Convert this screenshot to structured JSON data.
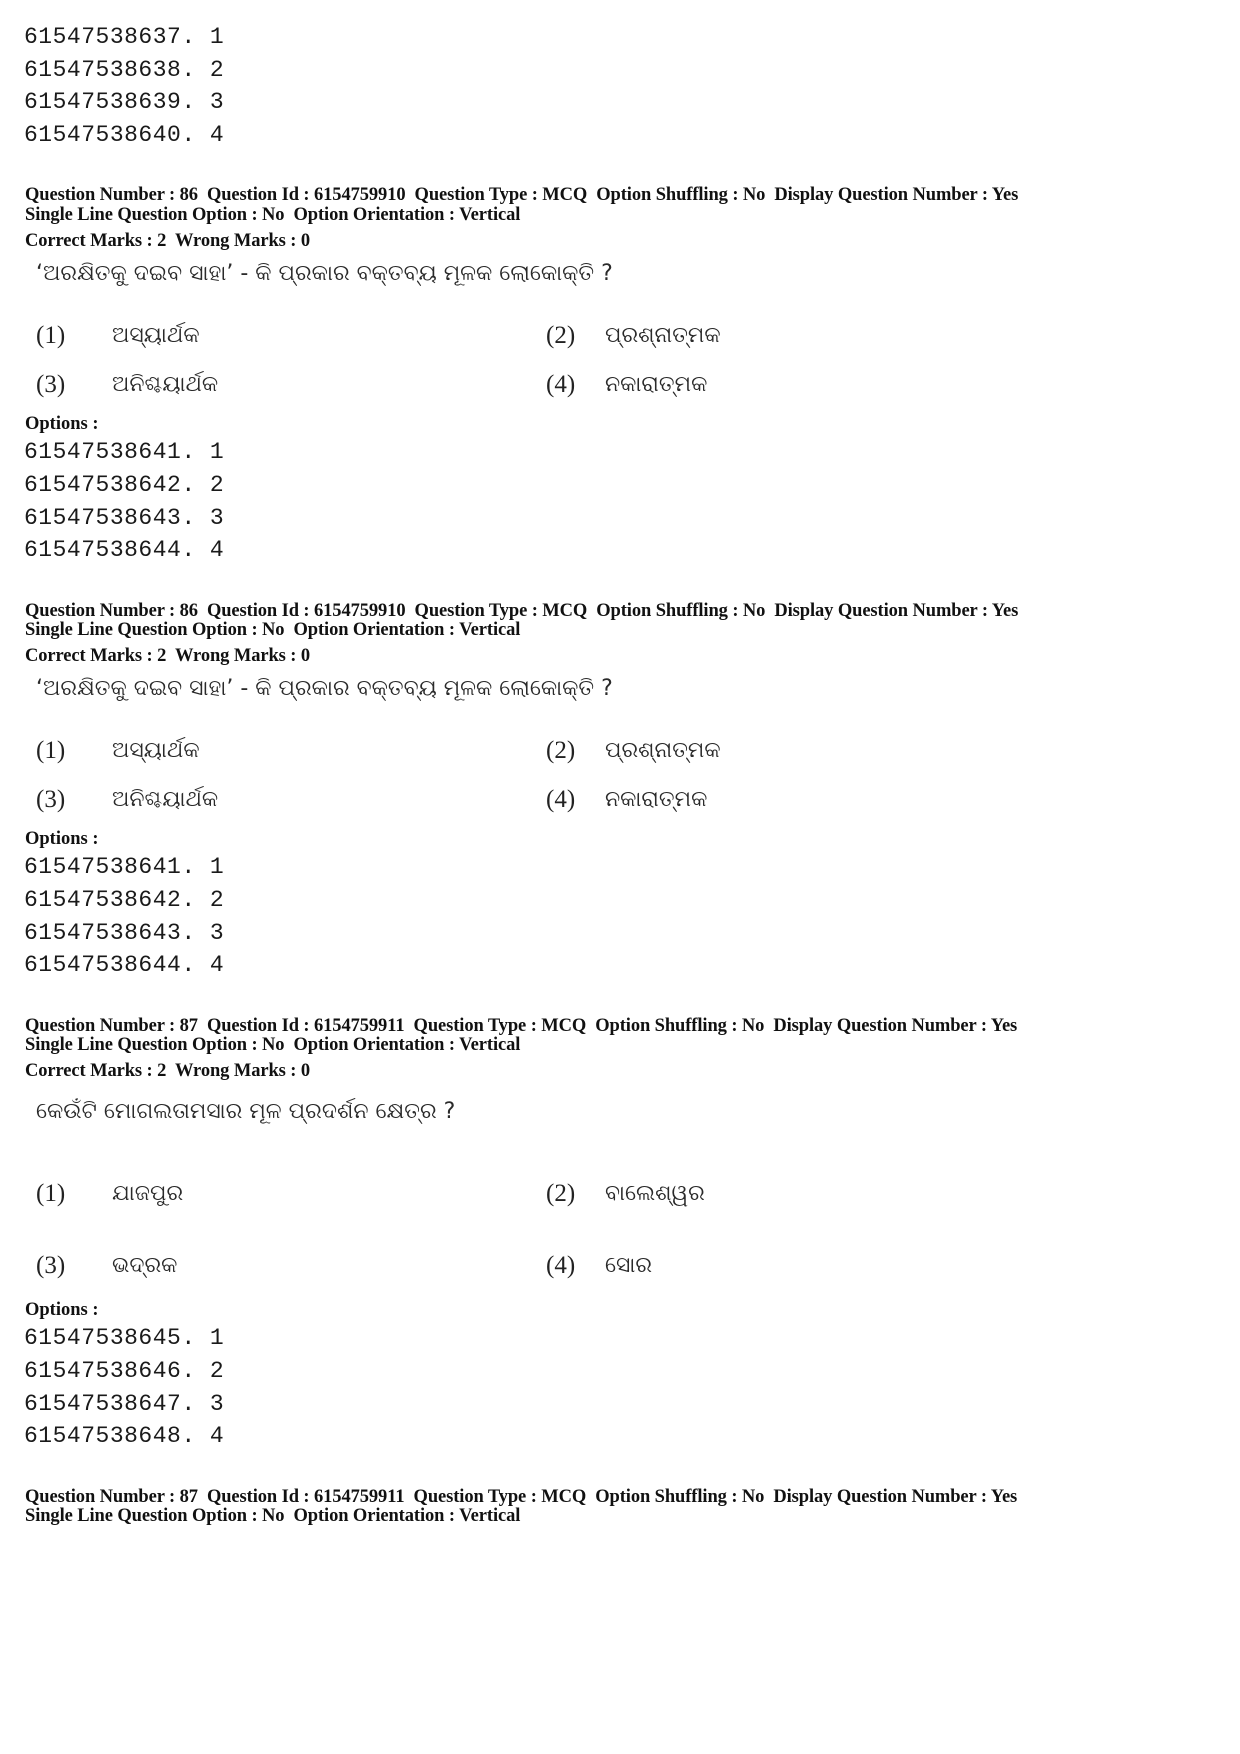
{
  "top_options": [
    "61547538637. 1",
    "61547538638. 2",
    "61547538639. 3",
    "61547538640. 4"
  ],
  "blocks": [
    {
      "meta_line1": "Question Number : 86  Question Id : 6154759910  Question Type : MCQ  Option Shuffling : No  Display Question Number : Yes",
      "meta_line2": "Single Line Question Option : No  Option Orientation : Vertical",
      "marks": "Correct Marks : 2  Wrong Marks : 0",
      "question": "‘ଅରକ୍ଷିତକୁ ଦଇବ ସାହା’ - କି ପ୍ରକାର ବକ୍ତବ୍ୟ ମୂଳକ ଲୋକୋକ୍ତି ?",
      "choices": [
        {
          "num": "(1)",
          "text": "ଅସ୍ୟାର୍ଥକ"
        },
        {
          "num": "(2)",
          "text": "ପ୍ରଶ୍ନାତ୍ମକ"
        },
        {
          "num": "(3)",
          "text": "ଅନିଶ୍ଚୟାର୍ଥକ"
        },
        {
          "num": "(4)",
          "text": "ନକାରାତ୍ମକ"
        }
      ],
      "options_label": "Options :",
      "options": [
        "61547538641. 1",
        "61547538642. 2",
        "61547538643. 3",
        "61547538644. 4"
      ]
    },
    {
      "meta_line1": "Question Number : 86  Question Id : 6154759910  Question Type : MCQ  Option Shuffling : No  Display Question Number : Yes",
      "meta_line2": "Single Line Question Option : No  Option Orientation : Vertical",
      "marks": "Correct Marks : 2  Wrong Marks : 0",
      "question": "‘ଅରକ୍ଷିତକୁ ଦଇବ ସାହା’ - କି ପ୍ରକାର ବକ୍ତବ୍ୟ ମୂଳକ ଲୋକୋକ୍ତି ?",
      "choices": [
        {
          "num": "(1)",
          "text": "ଅସ୍ୟାର୍ଥକ"
        },
        {
          "num": "(2)",
          "text": "ପ୍ରଶ୍ନାତ୍ମକ"
        },
        {
          "num": "(3)",
          "text": "ଅନିଶ୍ଚୟାର୍ଥକ"
        },
        {
          "num": "(4)",
          "text": "ନକାରାତ୍ମକ"
        }
      ],
      "options_label": "Options :",
      "options": [
        "61547538641. 1",
        "61547538642. 2",
        "61547538643. 3",
        "61547538644. 4"
      ]
    },
    {
      "meta_line1": "Question Number : 87  Question Id : 6154759911  Question Type : MCQ  Option Shuffling : No  Display Question Number : Yes",
      "meta_line2": "Single Line Question Option : No  Option Orientation : Vertical",
      "marks": "Correct Marks : 2  Wrong Marks : 0",
      "question": "କେଉଁଟି ମୋଗଲତାମସାର ମୂଳ ପ୍ରଦର୍ଶନ କ୍ଷେତ୍ର ?",
      "choices": [
        {
          "num": "(1)",
          "text": "ଯାଜପୁର"
        },
        {
          "num": "(2)",
          "text": "ବାଲେଶ୍ୱର"
        },
        {
          "num": "(3)",
          "text": "ଭଦ୍ରକ"
        },
        {
          "num": "(4)",
          "text": "ସୋର"
        }
      ],
      "options_label": "Options :",
      "options": [
        "61547538645. 1",
        "61547538646. 2",
        "61547538647. 3",
        "61547538648. 4"
      ]
    },
    {
      "meta_line1": "Question Number : 87  Question Id : 6154759911  Question Type : MCQ  Option Shuffling : No  Display Question Number : Yes",
      "meta_line2": "Single Line Question Option : No  Option Orientation : Vertical"
    }
  ]
}
